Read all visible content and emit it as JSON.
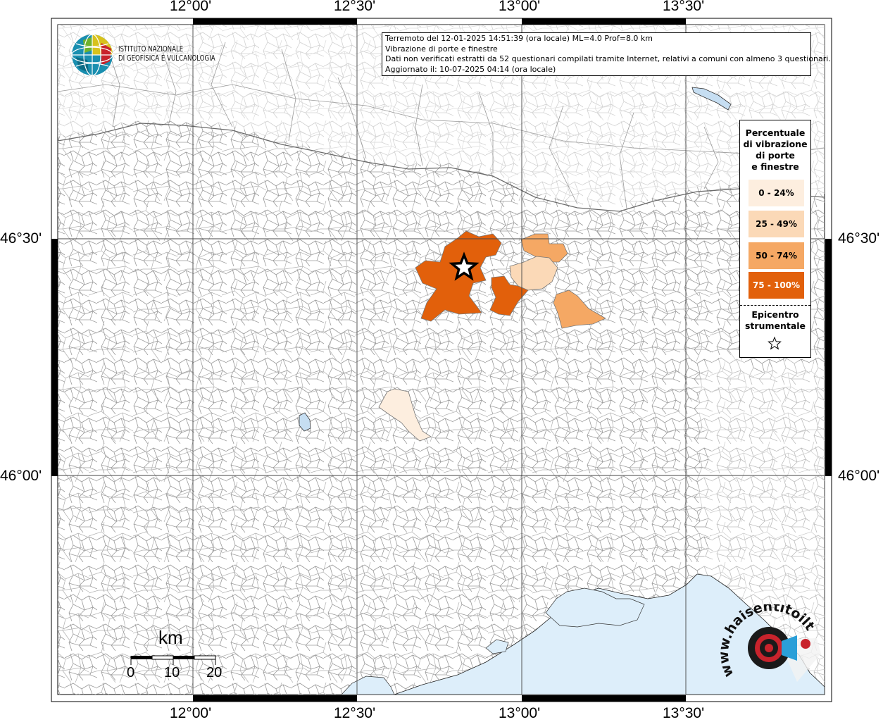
{
  "map": {
    "tick_labels": {
      "lon": [
        "12°00'",
        "12°30'",
        "13°00'",
        "13°30'"
      ],
      "lat": [
        "46°30'",
        "46°00'"
      ]
    },
    "colors": {
      "sea": "#ddeefa",
      "lake": "#c6def2",
      "class_0_24": "#fdeedf",
      "class_25_49": "#fbd9b7",
      "class_50_74": "#f5a864",
      "class_75_100": "#e2600b",
      "borders": "#8c8c8c",
      "graticule": "#444444"
    }
  },
  "info_box": {
    "line1": "Terremoto del 12-01-2025 14:51:39 (ora locale) ML=4.0 Prof=8.0 km",
    "line2": "Vibrazione di porte e finestre",
    "line3": "Dati non verificati estratti da 52 questionari compilati tramite Internet, relativi a comuni con almeno 3 questionari.",
    "line4": "Aggiornato il: 10-07-2025 04:14 (ora locale)"
  },
  "legend": {
    "title_lines": [
      "Percentuale",
      "di vibrazione",
      "di porte",
      "e finestre"
    ],
    "classes": [
      {
        "label": "0 - 24%",
        "color": "#fdeedf",
        "text_color": "#000000"
      },
      {
        "label": "25 - 49%",
        "color": "#fbd9b7",
        "text_color": "#000000"
      },
      {
        "label": "50 - 74%",
        "color": "#f5a864",
        "text_color": "#000000"
      },
      {
        "label": "75 - 100%",
        "color": "#e2600b",
        "text_color": "#ffffff"
      }
    ],
    "epicenter_lines": [
      "Epicentro",
      "strumentale"
    ]
  },
  "logo": {
    "line1": "ISTITUTO NAZIONALE",
    "line2": "DI GEOFISICA E VULCANOLOGIA"
  },
  "scale_bar": {
    "unit": "km",
    "labels": [
      "0",
      "10",
      "20"
    ]
  },
  "badge": {
    "text": "www.haisentitoilterremoto.it"
  }
}
